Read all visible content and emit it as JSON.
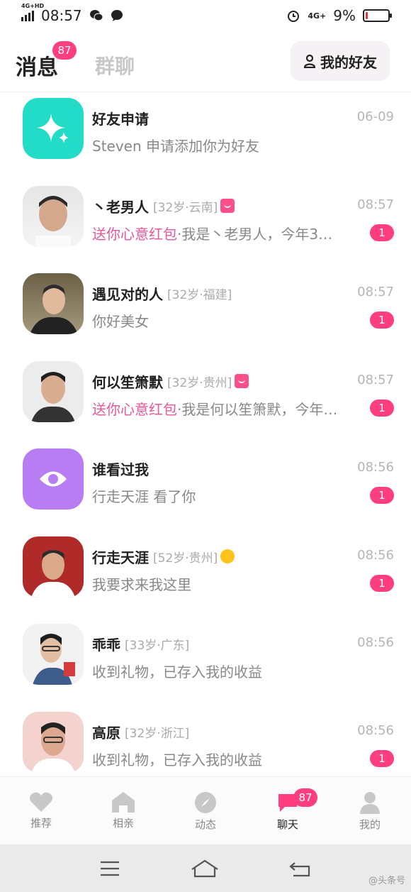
{
  "status": {
    "time": "08:57",
    "network": "4G+HD",
    "network_right": "4G+",
    "battery": "9%",
    "battery_fraction": 0.09
  },
  "header": {
    "tab_messages": "消息",
    "messages_badge": "87",
    "tab_group": "群聊",
    "friends_button": "我的好友"
  },
  "conversations": [
    {
      "name": "好友申请",
      "meta": "",
      "time": "06-09",
      "highlight": "",
      "preview": "Steven  申请添加你为好友",
      "unread": "",
      "avatar": "star-icon"
    },
    {
      "name": "丶老男人",
      "meta": "[32岁·云南]",
      "time": "08:57",
      "highlight": "送你心意红包",
      "preview": "·我是丶老男人，今年3…",
      "unread": "1",
      "avatar": "photo"
    },
    {
      "name": "遇见对的人",
      "meta": "[32岁·福建]",
      "time": "08:57",
      "highlight": "",
      "preview": "你好美女",
      "unread": "1",
      "avatar": "photo"
    },
    {
      "name": "何以笙箫默",
      "meta": "[32岁·贵州]",
      "time": "08:57",
      "highlight": "送你心意红包",
      "preview": "·我是何以笙箫默，今年…",
      "unread": "1",
      "avatar": "photo"
    },
    {
      "name": "谁看过我",
      "meta": "",
      "time": "08:56",
      "highlight": "",
      "preview": "行走天涯  看了你",
      "unread": "1",
      "avatar": "eye-icon"
    },
    {
      "name": "行走天涯",
      "meta": "[52岁·贵州]",
      "time": "08:56",
      "highlight": "",
      "preview": "我要求来我这里",
      "unread": "1",
      "avatar": "photo"
    },
    {
      "name": "乖乖",
      "meta": "[33岁·广东]",
      "time": "08:56",
      "highlight": "",
      "preview": "收到礼物，已存入我的收益",
      "unread": "",
      "avatar": "photo"
    },
    {
      "name": "高原",
      "meta": "[32岁·浙江]",
      "time": "08:56",
      "highlight": "",
      "preview": "收到礼物，已存入我的收益",
      "unread": "1",
      "avatar": "photo"
    }
  ],
  "bottom_nav": [
    {
      "label": "推荐",
      "icon": "heart-icon"
    },
    {
      "label": "相亲",
      "icon": "house-icon"
    },
    {
      "label": "动态",
      "icon": "compass-icon"
    },
    {
      "label": "聊天",
      "icon": "chat-icon",
      "badge": "87"
    },
    {
      "label": "我的",
      "icon": "person-icon"
    }
  ],
  "colors": {
    "accent": "#ff3e7f",
    "highlight_text": "#e8579b",
    "star_tile": "#22dcc8",
    "eye_tile": "#b97df3"
  },
  "watermark": "@头条号"
}
